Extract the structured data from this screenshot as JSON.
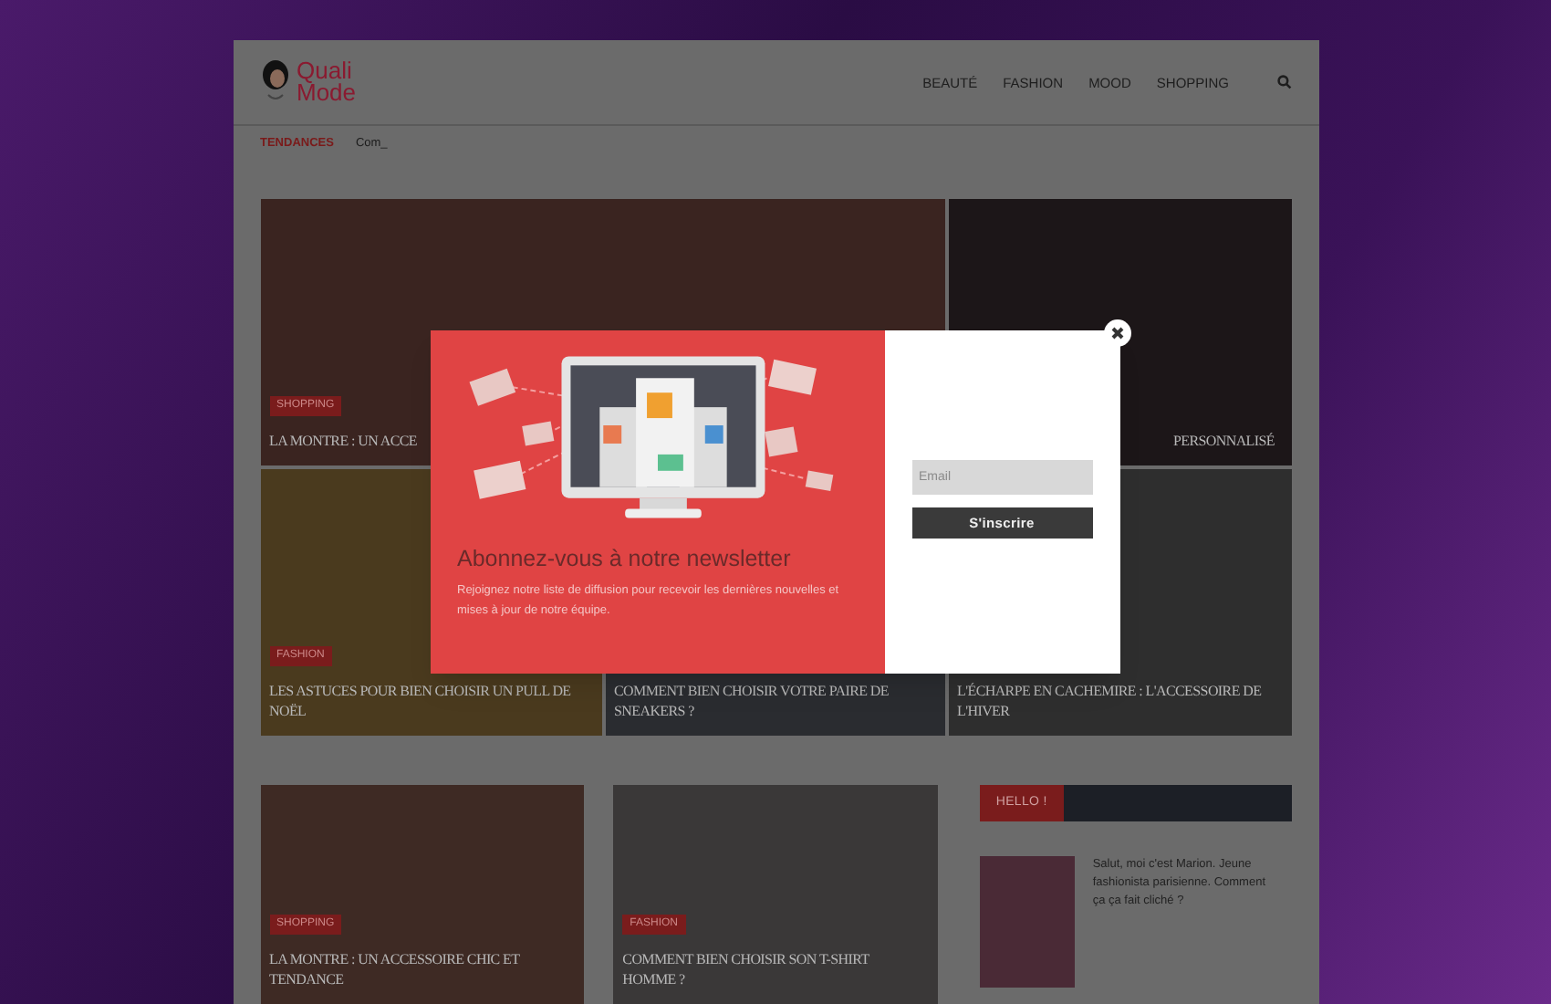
{
  "header": {
    "logo_line_1": "Quali",
    "logo_line_2": "Mode",
    "nav": [
      "BEAUTÉ",
      "FASHION",
      "MOOD",
      "SHOPPING"
    ]
  },
  "ticker": {
    "label": "TENDANCES",
    "text": "Com_"
  },
  "featured": [
    {
      "tag": "SHOPPING",
      "title": "LA MONTRE : UN ACCE"
    },
    {
      "title": "PERSONNALISÉ"
    },
    {
      "tag": "FASHION",
      "title": "LES ASTUCES POUR BIEN CHOISIR UN PULL DE NOËL"
    },
    {
      "title": "COMMENT BIEN CHOISIR VOTRE PAIRE DE SNEAKERS ?"
    },
    {
      "title": "L'ÉCHARPE EN CACHEMIRE : L'ACCESSOIRE DE L'HIVER"
    }
  ],
  "popup": {
    "title": "Abonnez-vous à notre newsletter",
    "text": "Rejoignez notre liste de diffusion pour recevoir les dernières nouvelles et mises à jour de notre équipe.",
    "email_placeholder": "Email",
    "button": "S'inscrire"
  },
  "posts": [
    {
      "tag": "SHOPPING",
      "title": "LA MONTRE : UN ACCESSOIRE CHIC ET TENDANCE"
    },
    {
      "tag": "FASHION",
      "title": "COMMENT BIEN CHOISIR SON T-SHIRT HOMME ?"
    }
  ],
  "sidebar": {
    "heading": "HELLO !",
    "text": "Salut, moi c'est Marion. Jeune fashionista parisienne. Comment ça ça fait cliché ?"
  }
}
